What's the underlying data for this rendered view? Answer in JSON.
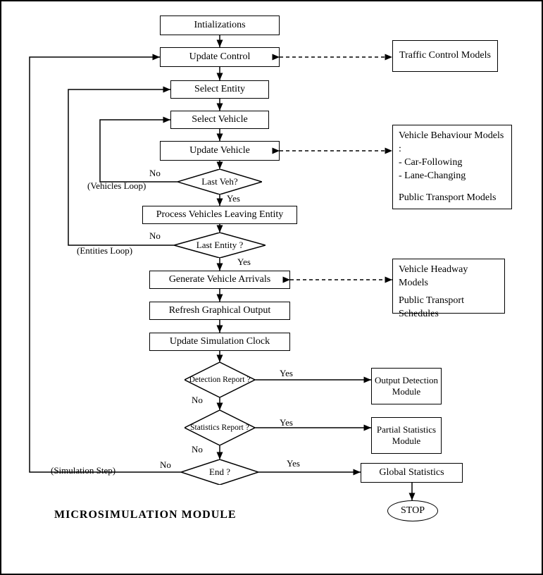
{
  "nodes": {
    "initializations": "Intializations",
    "update_control": "Update Control",
    "select_entity": "Select Entity",
    "select_vehicle": "Select Vehicle",
    "update_vehicle": "Update Vehicle",
    "last_veh": "Last Veh?",
    "process_leaving": "Process Vehicles Leaving Entity",
    "last_entity": "Last Entity ?",
    "generate_arrivals": "Generate Vehicle Arrivals",
    "refresh_output": "Refresh Graphical Output",
    "update_clock": "Update Simulation Clock",
    "detection_report": "Detection Report ?",
    "statistics_report": "Statistics Report ?",
    "end": "End ?",
    "output_detection": "Output Detection Module",
    "partial_stats": "Partial Statistics Module",
    "global_stats": "Global Statistics",
    "stop": "STOP"
  },
  "side_boxes": {
    "traffic_control": "Traffic Control Models",
    "vehicle_behaviour_l1": "Vehicle Behaviour Models :",
    "vehicle_behaviour_l2": "- Car-Following",
    "vehicle_behaviour_l3": "- Lane-Changing",
    "vehicle_behaviour_l4": "Public Transport Models",
    "headway_l1": "Vehicle Headway Models",
    "headway_l2": "Public Transport Schedules"
  },
  "edge_labels": {
    "yes": "Yes",
    "no": "No",
    "vehicles_loop": "(Vehicles Loop)",
    "entities_loop": "(Entities Loop)",
    "simulation_step": "(Simulation Step)"
  },
  "title": "MICROSIMULATION MODULE",
  "chart_data": {
    "type": "flowchart",
    "title": "MICROSIMULATION MODULE",
    "nodes": [
      {
        "id": "init",
        "type": "process",
        "label": "Intializations"
      },
      {
        "id": "upd_ctrl",
        "type": "process",
        "label": "Update Control"
      },
      {
        "id": "sel_ent",
        "type": "process",
        "label": "Select Entity"
      },
      {
        "id": "sel_veh",
        "type": "process",
        "label": "Select Vehicle"
      },
      {
        "id": "upd_veh",
        "type": "process",
        "label": "Update Vehicle"
      },
      {
        "id": "last_veh",
        "type": "decision",
        "label": "Last Veh?"
      },
      {
        "id": "proc_leave",
        "type": "process",
        "label": "Process Vehicles Leaving Entity"
      },
      {
        "id": "last_ent",
        "type": "decision",
        "label": "Last Entity ?"
      },
      {
        "id": "gen_arr",
        "type": "process",
        "label": "Generate Vehicle Arrivals"
      },
      {
        "id": "refresh",
        "type": "process",
        "label": "Refresh Graphical Output"
      },
      {
        "id": "upd_clock",
        "type": "process",
        "label": "Update Simulation Clock"
      },
      {
        "id": "det_rep",
        "type": "decision",
        "label": "Detection Report ?"
      },
      {
        "id": "stat_rep",
        "type": "decision",
        "label": "Statistics Report ?"
      },
      {
        "id": "end",
        "type": "decision",
        "label": "End ?"
      },
      {
        "id": "out_det",
        "type": "process",
        "label": "Output Detection Module"
      },
      {
        "id": "part_stat",
        "type": "process",
        "label": "Partial Statistics Module"
      },
      {
        "id": "glob_stat",
        "type": "process",
        "label": "Global Statistics"
      },
      {
        "id": "stop",
        "type": "terminator",
        "label": "STOP"
      },
      {
        "id": "tcm",
        "type": "external",
        "label": "Traffic Control Models"
      },
      {
        "id": "vbm",
        "type": "external",
        "label": "Vehicle Behaviour Models : - Car-Following - Lane-Changing; Public Transport Models"
      },
      {
        "id": "vhm",
        "type": "external",
        "label": "Vehicle Headway Models; Public Transport Schedules"
      }
    ],
    "edges": [
      {
        "from": "init",
        "to": "upd_ctrl"
      },
      {
        "from": "upd_ctrl",
        "to": "sel_ent"
      },
      {
        "from": "sel_ent",
        "to": "sel_veh"
      },
      {
        "from": "sel_veh",
        "to": "upd_veh"
      },
      {
        "from": "upd_veh",
        "to": "last_veh"
      },
      {
        "from": "last_veh",
        "to": "sel_veh",
        "label": "No",
        "note": "Vehicles Loop"
      },
      {
        "from": "last_veh",
        "to": "proc_leave",
        "label": "Yes"
      },
      {
        "from": "proc_leave",
        "to": "last_ent"
      },
      {
        "from": "last_ent",
        "to": "sel_ent",
        "label": "No",
        "note": "Entities Loop"
      },
      {
        "from": "last_ent",
        "to": "gen_arr",
        "label": "Yes"
      },
      {
        "from": "gen_arr",
        "to": "refresh"
      },
      {
        "from": "refresh",
        "to": "upd_clock"
      },
      {
        "from": "upd_clock",
        "to": "det_rep"
      },
      {
        "from": "det_rep",
        "to": "out_det",
        "label": "Yes"
      },
      {
        "from": "det_rep",
        "to": "stat_rep",
        "label": "No"
      },
      {
        "from": "stat_rep",
        "to": "part_stat",
        "label": "Yes"
      },
      {
        "from": "stat_rep",
        "to": "end",
        "label": "No"
      },
      {
        "from": "end",
        "to": "glob_stat",
        "label": "Yes"
      },
      {
        "from": "end",
        "to": "upd_ctrl",
        "label": "No",
        "note": "Simulation Step"
      },
      {
        "from": "glob_stat",
        "to": "stop"
      },
      {
        "from": "upd_ctrl",
        "to": "tcm",
        "style": "dashed-bidirectional"
      },
      {
        "from": "upd_veh",
        "to": "vbm",
        "style": "dashed-bidirectional"
      },
      {
        "from": "gen_arr",
        "to": "vhm",
        "style": "dashed-bidirectional"
      }
    ]
  }
}
